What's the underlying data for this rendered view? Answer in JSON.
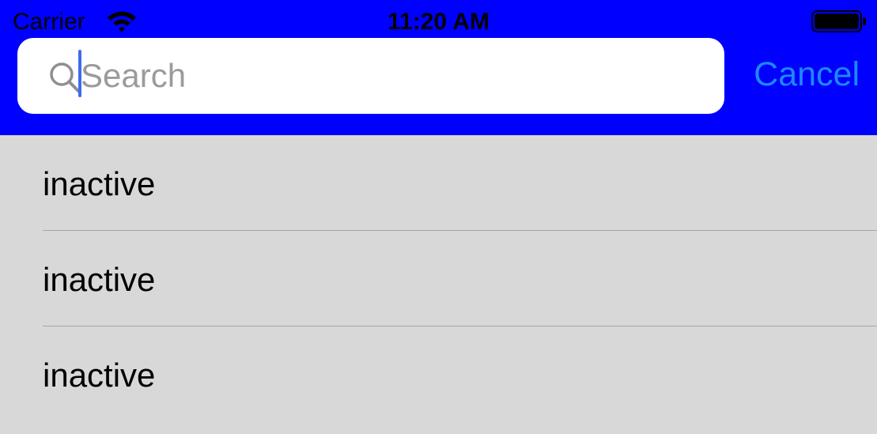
{
  "status_bar": {
    "carrier": "Carrier",
    "time": "11:20 AM",
    "wifi_icon": "wifi-icon",
    "battery_icon": "battery-full-icon"
  },
  "search": {
    "placeholder": "Search",
    "value": "",
    "icon": "magnifying-glass-icon",
    "cancel_label": "Cancel"
  },
  "colors": {
    "header_background": "#0000ff",
    "list_background": "#d8d8d8",
    "cancel_text": "#1e88ff",
    "caret": "#3d6cf0"
  },
  "rows": [
    {
      "label": "inactive"
    },
    {
      "label": "inactive"
    },
    {
      "label": "inactive"
    }
  ]
}
